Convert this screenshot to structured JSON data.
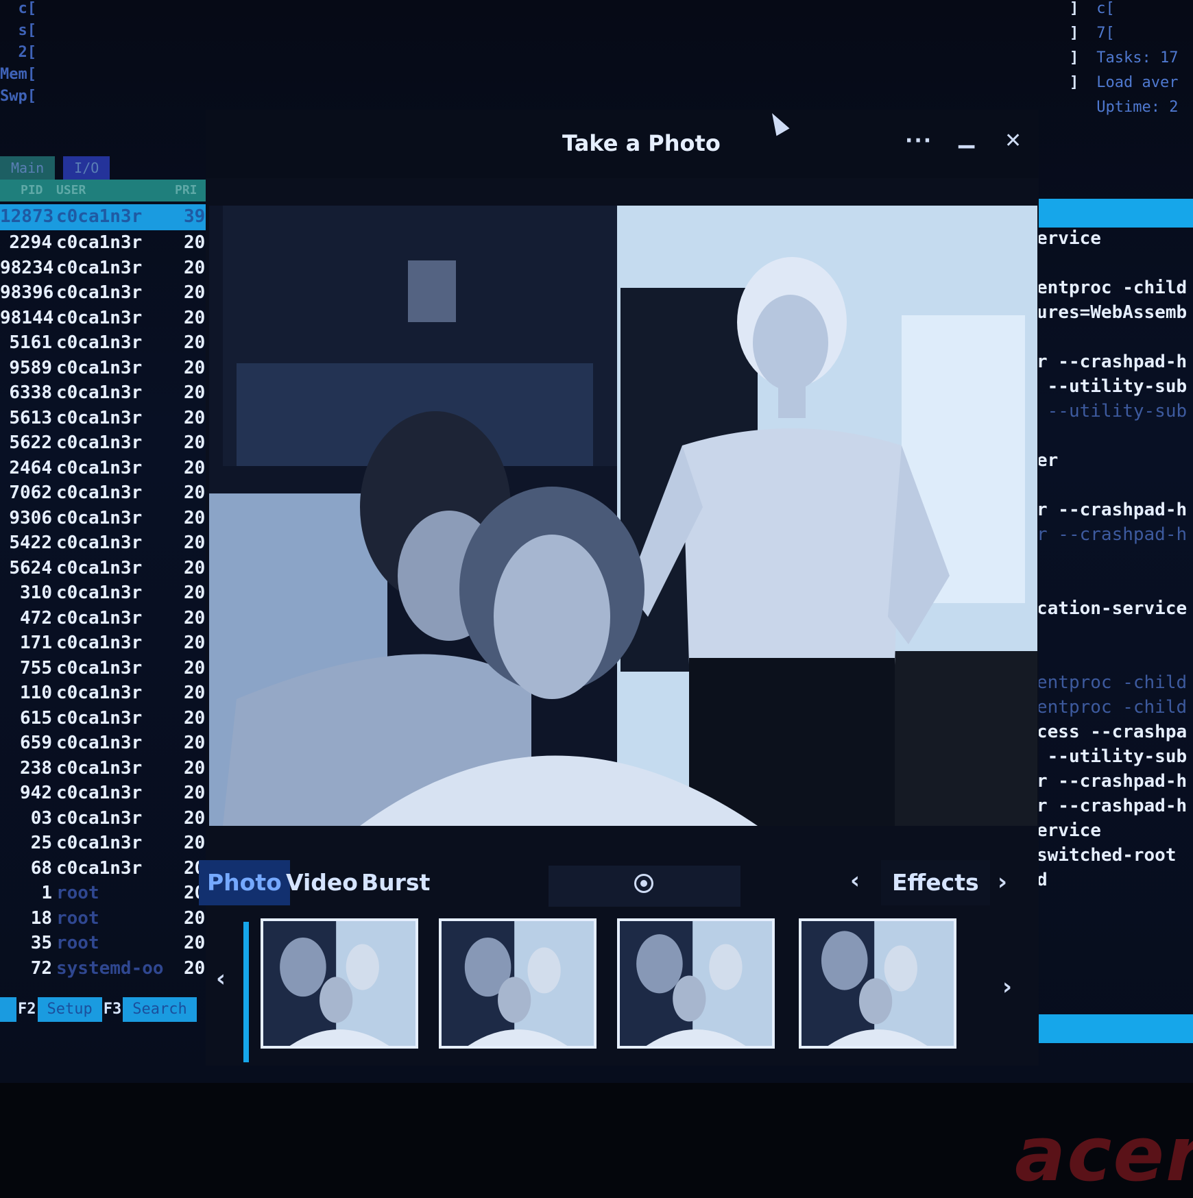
{
  "terminal": {
    "top_meters": [
      "  c[",
      "  s[",
      "  2[",
      "Mem[",
      "Swp["
    ],
    "right_meters": [
      "c[",
      "7[",
      "Tasks: 17",
      "Load aver",
      "Uptime: 2"
    ],
    "tabs": {
      "main": "Main",
      "io": "I/O"
    },
    "header": {
      "pid": "PID",
      "user": "USER",
      "pri": "PRI"
    },
    "processes": [
      {
        "pid": "12873",
        "user": "c0ca1n3r",
        "pri": "39"
      },
      {
        "pid": "2294",
        "user": "c0ca1n3r",
        "pri": "20"
      },
      {
        "pid": "98234",
        "user": "c0ca1n3r",
        "pri": "20"
      },
      {
        "pid": "98396",
        "user": "c0ca1n3r",
        "pri": "20"
      },
      {
        "pid": "98144",
        "user": "c0ca1n3r",
        "pri": "20"
      },
      {
        "pid": "5161",
        "user": "c0ca1n3r",
        "pri": "20"
      },
      {
        "pid": "9589",
        "user": "c0ca1n3r",
        "pri": "20"
      },
      {
        "pid": "6338",
        "user": "c0ca1n3r",
        "pri": "20"
      },
      {
        "pid": "5613",
        "user": "c0ca1n3r",
        "pri": "20"
      },
      {
        "pid": "5622",
        "user": "c0ca1n3r",
        "pri": "20"
      },
      {
        "pid": "2464",
        "user": "c0ca1n3r",
        "pri": "20"
      },
      {
        "pid": "7062",
        "user": "c0ca1n3r",
        "pri": "20"
      },
      {
        "pid": "9306",
        "user": "c0ca1n3r",
        "pri": "20"
      },
      {
        "pid": "5422",
        "user": "c0ca1n3r",
        "pri": "20"
      },
      {
        "pid": "5624",
        "user": "c0ca1n3r",
        "pri": "20"
      },
      {
        "pid": "310",
        "user": "c0ca1n3r",
        "pri": "20"
      },
      {
        "pid": "472",
        "user": "c0ca1n3r",
        "pri": "20"
      },
      {
        "pid": "171",
        "user": "c0ca1n3r",
        "pri": "20"
      },
      {
        "pid": "755",
        "user": "c0ca1n3r",
        "pri": "20"
      },
      {
        "pid": "110",
        "user": "c0ca1n3r",
        "pri": "20"
      },
      {
        "pid": "615",
        "user": "c0ca1n3r",
        "pri": "20"
      },
      {
        "pid": "659",
        "user": "c0ca1n3r",
        "pri": "20"
      },
      {
        "pid": "238",
        "user": "c0ca1n3r",
        "pri": "20"
      },
      {
        "pid": "942",
        "user": "c0ca1n3r",
        "pri": "20"
      },
      {
        "pid": "03",
        "user": "c0ca1n3r",
        "pri": "20"
      },
      {
        "pid": "25",
        "user": "c0ca1n3r",
        "pri": "20"
      },
      {
        "pid": "68",
        "user": "c0ca1n3r",
        "pri": "20"
      },
      {
        "pid": "1",
        "user": "root",
        "pri": "20"
      },
      {
        "pid": "18",
        "user": "root",
        "pri": "20"
      },
      {
        "pid": "35",
        "user": "root",
        "pri": "20"
      },
      {
        "pid": "72",
        "user": "systemd-oo",
        "pri": "20"
      }
    ],
    "fn_keys": [
      {
        "key": "F2",
        "label": "Setup"
      },
      {
        "key": "F3",
        "label": "Search"
      }
    ],
    "commands": [
      "ervice",
      "",
      "entproc -child",
      "ures=WebAssemb",
      "",
      "r --crashpad-h",
      " --utility-sub",
      " --utility-sub",
      "",
      "er",
      "",
      "r --crashpad-h",
      "r --crashpad-h",
      "",
      "",
      "cation-service",
      "",
      "",
      "entproc -child",
      "entproc -child",
      "cess --crashpa",
      " --utility-sub",
      "r --crashpad-h",
      "r --crashpad-h",
      "ervice",
      "switched-root",
      "d"
    ]
  },
  "camera_app": {
    "title": "Take a Photo",
    "menu_icon": "more-icon",
    "minimize_icon": "minimize-icon",
    "close_icon": "close-icon",
    "modes": [
      "Photo",
      "Video",
      "Burst"
    ],
    "active_mode": "Photo",
    "effects_label": "Effects",
    "prev_arrow": "‹",
    "next_arrow": "›",
    "thumbnail_count": 4
  },
  "brand": "acer",
  "colors": {
    "accent": "#16a6ea",
    "terminal_text": "#e6efff",
    "active_tab": "#12306f"
  }
}
